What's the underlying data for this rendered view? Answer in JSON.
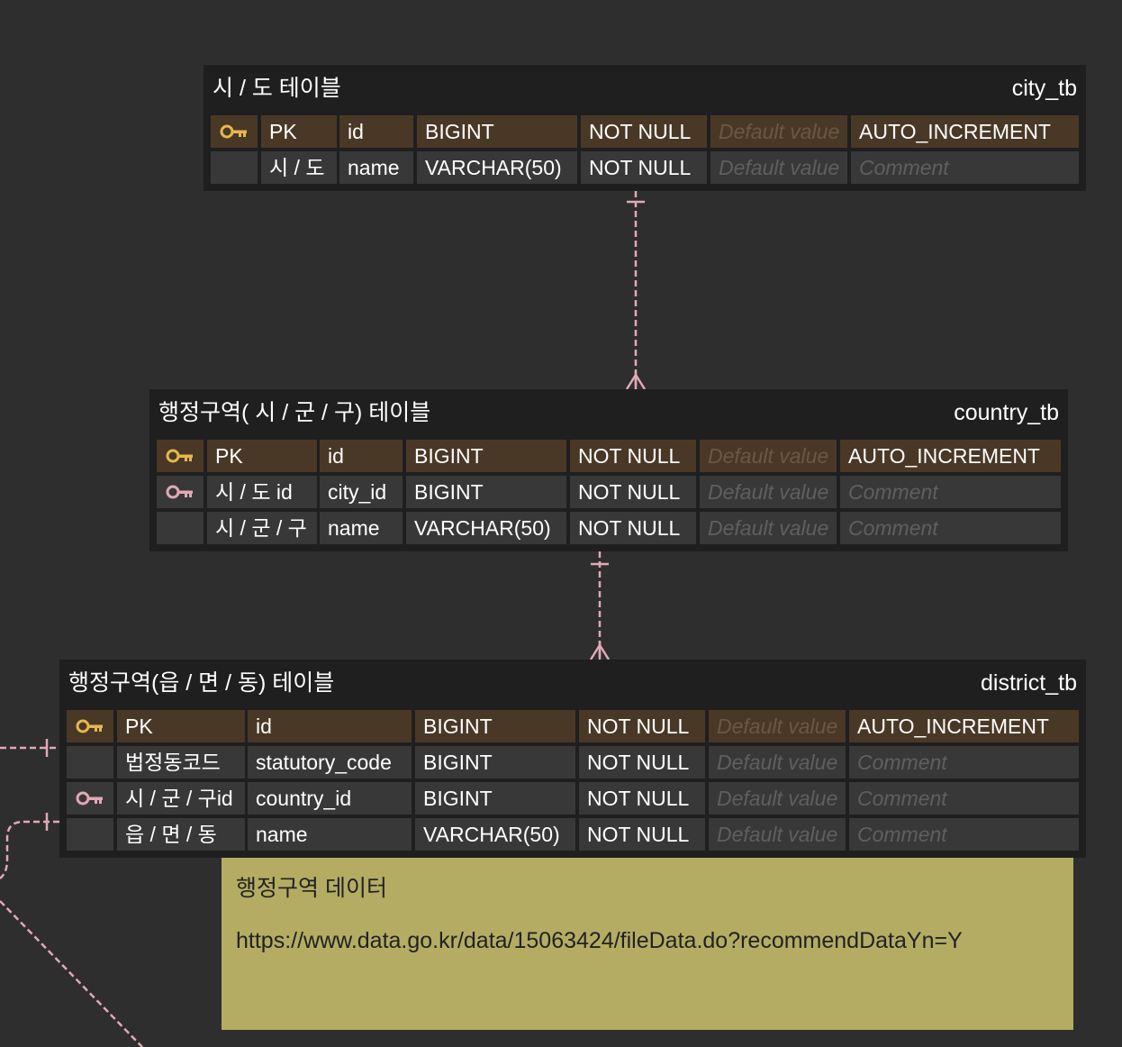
{
  "colors": {
    "background": "#2e2e2e",
    "table_bg": "#1f1f1f",
    "pk_row": "#4a3826",
    "row": "#383838",
    "pk_key": "#e4b84a",
    "fk_key": "#e0a9b6",
    "connector": "#e0a9b6",
    "note_bg": "#b4ac63"
  },
  "tables": [
    {
      "logical_name": "시 / 도 테이블",
      "physical_name": "city_tb",
      "columns": [
        {
          "key": "pk",
          "logical": "PK",
          "name": "id",
          "type": "BIGINT",
          "nullable": "NOT NULL",
          "default": "Default value",
          "extra": "AUTO_INCREMENT",
          "extra_placeholder": false
        },
        {
          "key": "",
          "logical": "시 / 도",
          "name": "name",
          "type": "VARCHAR(50)",
          "nullable": "NOT NULL",
          "default": "Default value",
          "extra": "Comment",
          "extra_placeholder": true
        }
      ]
    },
    {
      "logical_name": "행정구역( 시 / 군 / 구) 테이블",
      "physical_name": "country_tb",
      "columns": [
        {
          "key": "pk",
          "logical": "PK",
          "name": "id",
          "type": "BIGINT",
          "nullable": "NOT NULL",
          "default": "Default value",
          "extra": "AUTO_INCREMENT",
          "extra_placeholder": false
        },
        {
          "key": "fk",
          "logical": "시 / 도 id",
          "name": "city_id",
          "type": "BIGINT",
          "nullable": "NOT NULL",
          "default": "Default value",
          "extra": "Comment",
          "extra_placeholder": true
        },
        {
          "key": "",
          "logical": "시 / 군 / 구",
          "name": "name",
          "type": "VARCHAR(50)",
          "nullable": "NOT NULL",
          "default": "Default value",
          "extra": "Comment",
          "extra_placeholder": true
        }
      ]
    },
    {
      "logical_name": "행정구역(읍 / 면 / 동) 테이블",
      "physical_name": "district_tb",
      "columns": [
        {
          "key": "pk",
          "logical": "PK",
          "name": "id",
          "type": "BIGINT",
          "nullable": "NOT NULL",
          "default": "Default value",
          "extra": "AUTO_INCREMENT",
          "extra_placeholder": false
        },
        {
          "key": "",
          "logical": "법정동코드",
          "name": "statutory_code",
          "type": "BIGINT",
          "nullable": "NOT NULL",
          "default": "Default value",
          "extra": "Comment",
          "extra_placeholder": true
        },
        {
          "key": "fk",
          "logical": "시 / 군 / 구id",
          "name": "country_id",
          "type": "BIGINT",
          "nullable": "NOT NULL",
          "default": "Default value",
          "extra": "Comment",
          "extra_placeholder": true
        },
        {
          "key": "",
          "logical": "읍 / 면 / 동",
          "name": "name",
          "type": "VARCHAR(50)",
          "nullable": "NOT NULL",
          "default": "Default value",
          "extra": "Comment",
          "extra_placeholder": true
        }
      ]
    }
  ],
  "note": {
    "title": "행정구역 데이터",
    "body": "https://www.data.go.kr/data/15063424/fileData.do?recommendDataYn=Y"
  }
}
